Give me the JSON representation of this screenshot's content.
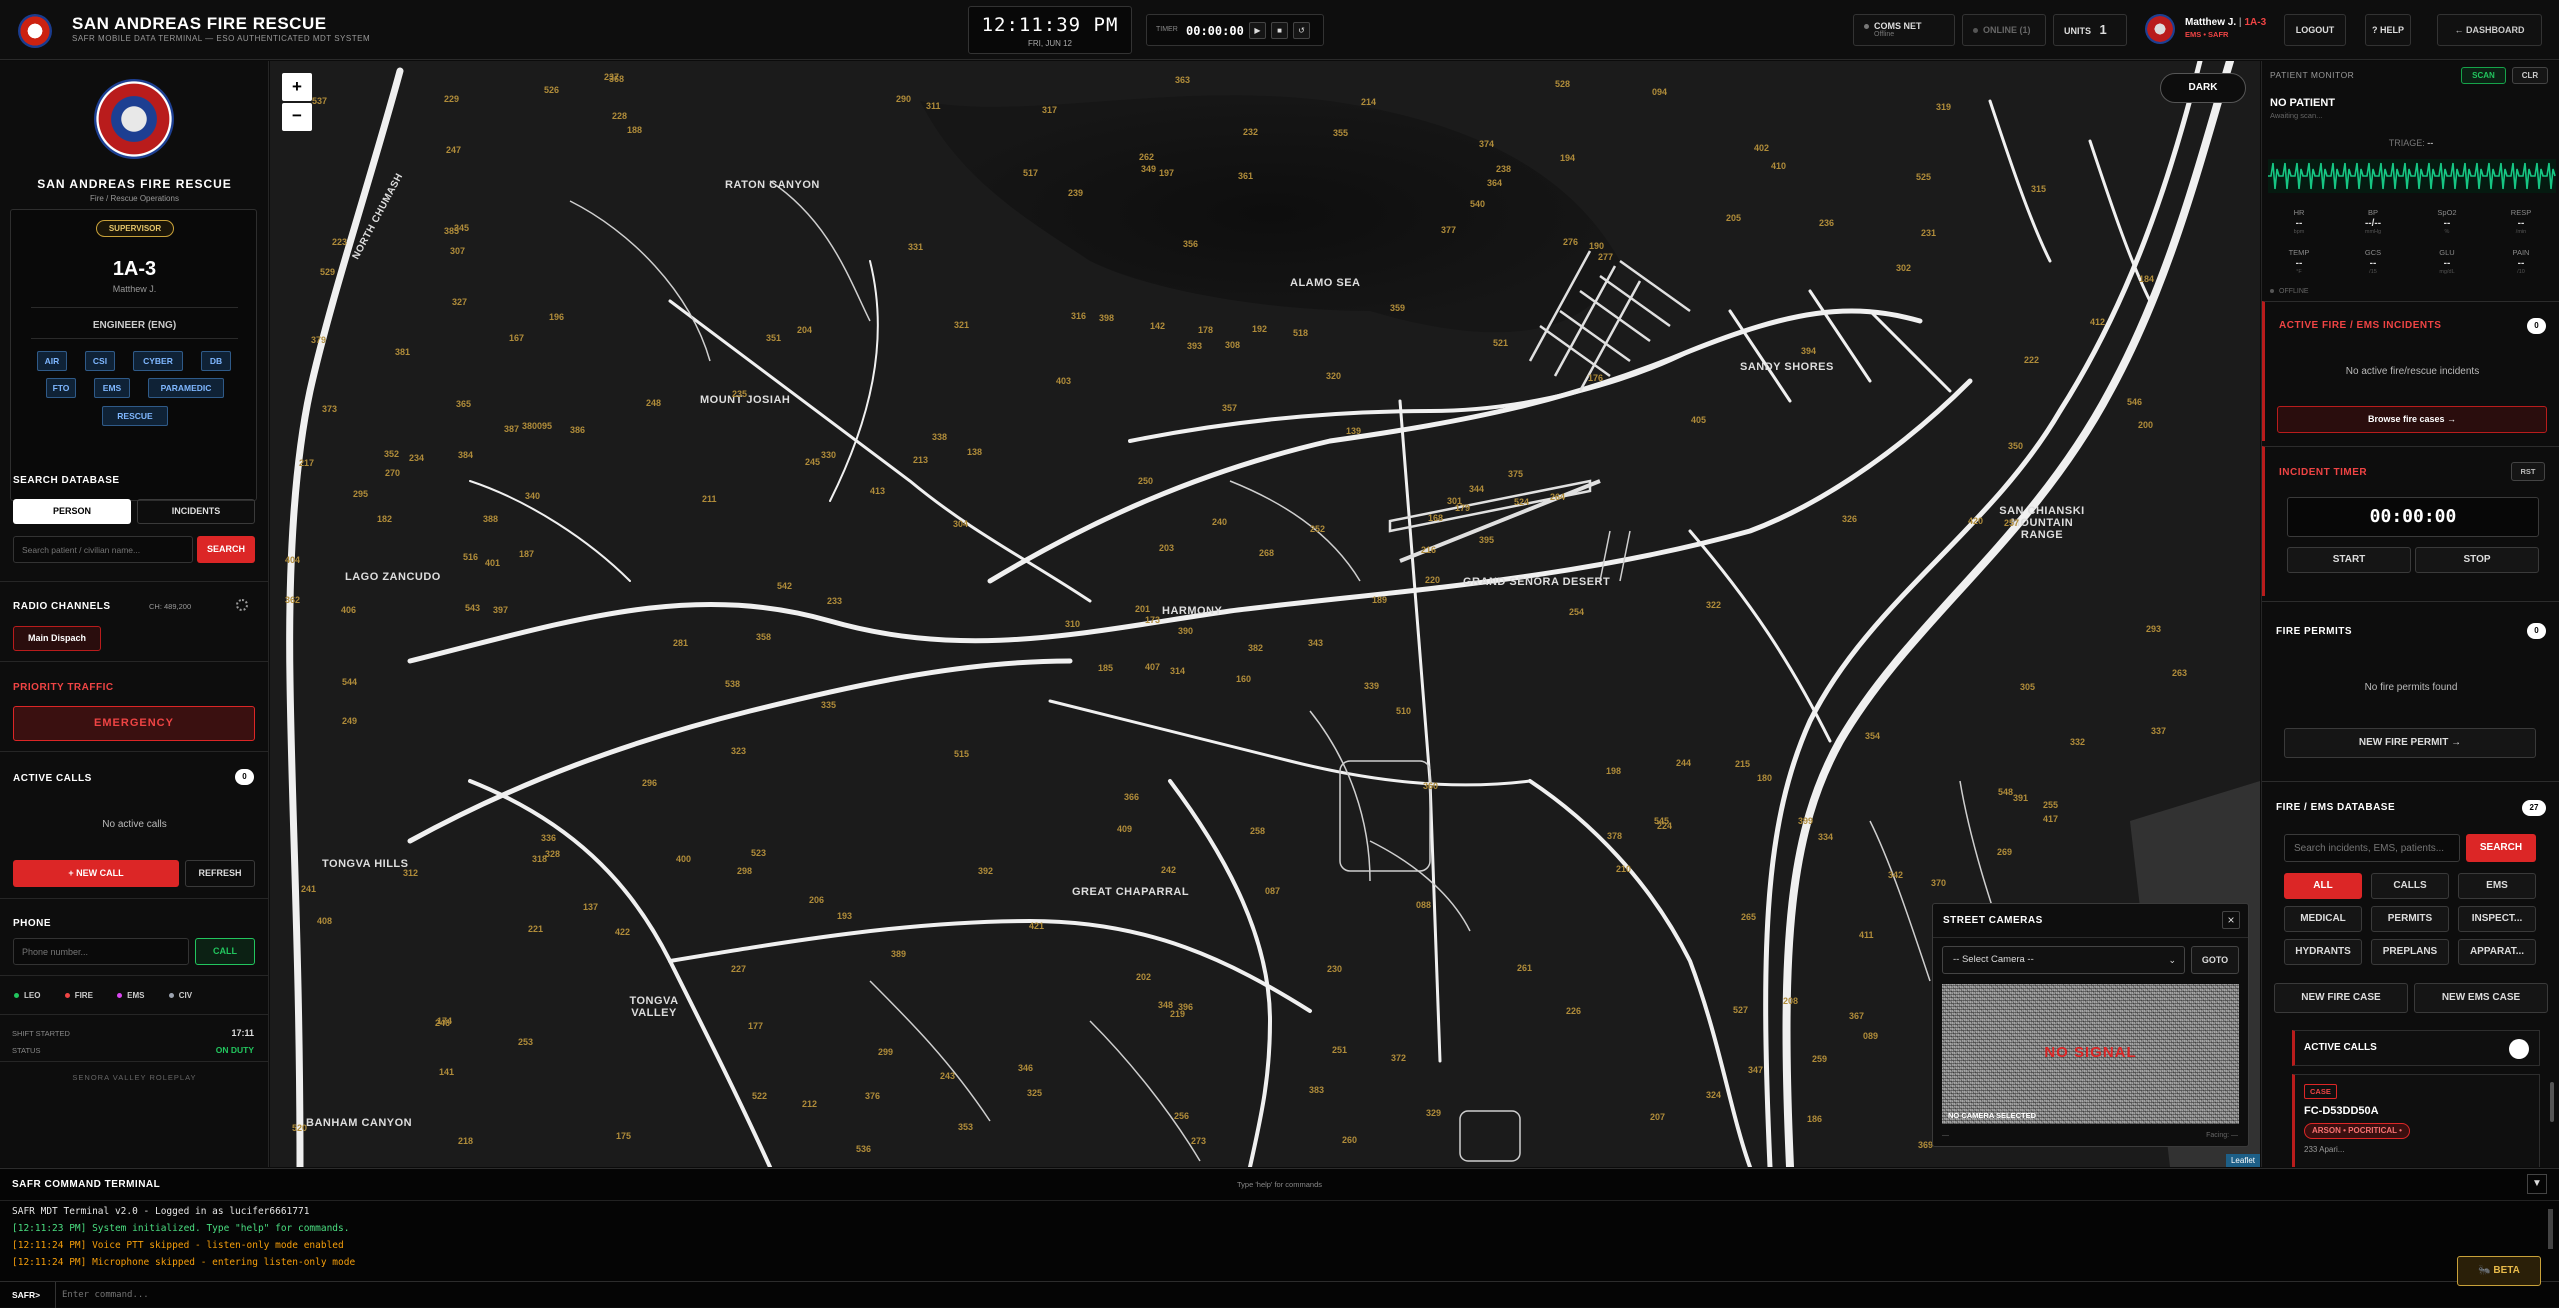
{
  "header": {
    "title": "SAN ANDREAS FIRE RESCUE",
    "subtitle": "SAFR MOBILE DATA TERMINAL — ESO AUTHENTICATED MDT SYSTEM",
    "clock": "12:11:39 PM",
    "date": "FRI, JUN 12",
    "timer_label": "TIMER",
    "timer_value": "00:00:00",
    "timer_play": "▶",
    "timer_stop": "■",
    "timer_reset": "↺",
    "comms_label": "COMS NET",
    "comms_sub": "Offline",
    "online_label": "ONLINE (1)",
    "units_label": "UNITS",
    "units_count": "1",
    "user_name": "Matthew J.",
    "user_unit": "1A-3",
    "user_dept": "EMS • SAFR",
    "logout": "LOGOUT",
    "help": "? HELP",
    "dashboard": "← DASHBOARD"
  },
  "sidebar": {
    "org_name": "SAN ANDREAS FIRE RESCUE",
    "org_sub": "Fire / Rescue Operations",
    "rank_badge": "SUPERVISOR",
    "callsign": "1A-3",
    "user": "Matthew J.",
    "role": "ENGINEER (ENG)",
    "certs": [
      "AIR",
      "CSI",
      "CYBER",
      "DB",
      "FTO",
      "EMS",
      "PARAMEDIC",
      "RESCUE"
    ],
    "search_title": "SEARCH DATABASE",
    "tab_person": "PERSON",
    "tab_incidents": "INCIDENTS",
    "search_placeholder": "Search patient / civilian name...",
    "search_button": "SEARCH",
    "radio_title": "RADIO CHANNELS",
    "radio_ch": "CH: 489,200",
    "radio_channel": "Main Dispach",
    "priority_title": "PRIORITY TRAFFIC",
    "emergency_button": "EMERGENCY",
    "calls_title": "ACTIVE CALLS",
    "calls_count": "0",
    "calls_empty": "No active calls",
    "new_call": "+ NEW CALL",
    "refresh": "REFRESH",
    "phone_title": "PHONE",
    "phone_placeholder": "Phone number...",
    "call_button": "CALL",
    "legend": [
      {
        "label": "LEO",
        "color": "#22c55e"
      },
      {
        "label": "FIRE",
        "color": "#ef4444"
      },
      {
        "label": "EMS",
        "color": "#d946ef"
      },
      {
        "label": "CIV",
        "color": "#9ca3af"
      }
    ],
    "shift_label": "SHIFT STARTED",
    "shift_value": "17:11",
    "status_label": "STATUS",
    "status_value": "ON DUTY",
    "footer": "SENORA VALLEY ROLEPLAY"
  },
  "map": {
    "zoom_in": "+",
    "zoom_out": "−",
    "theme_button": "DARK",
    "attribution": "Leaflet",
    "labels": [
      "RATON CANYON",
      "ALAMO SEA",
      "MOUNT JOSIAH",
      "SANDY SHORES",
      "LAGO ZANCUDO",
      "HARMONY",
      "GRAND SENORA DESERT",
      "SAN CHIANSKI MOUNTAIN RANGE",
      "TONGVA HILLS",
      "GREAT CHAPARRAL",
      "TONGVA VALLEY",
      "BANHAM CANYON",
      "NORTH CHUMASH"
    ],
    "postals": [
      "160",
      "167",
      "173",
      "174",
      "168",
      "193",
      "194",
      "192",
      "190",
      "189",
      "188",
      "186",
      "187",
      "184",
      "185",
      "176",
      "175",
      "142",
      "139",
      "137",
      "138",
      "141",
      "177",
      "178",
      "179",
      "180",
      "196",
      "197",
      "182",
      "198",
      "200",
      "201",
      "202",
      "203",
      "204",
      "205",
      "206",
      "207",
      "208",
      "215",
      "214",
      "213",
      "211",
      "210",
      "212",
      "217",
      "216",
      "218",
      "219",
      "220",
      "221",
      "222",
      "223",
      "224",
      "226",
      "227",
      "228",
      "229",
      "230",
      "231",
      "232",
      "233",
      "234",
      "235",
      "236",
      "237",
      "238",
      "239",
      "240",
      "241",
      "242",
      "243",
      "244",
      "245",
      "246",
      "247",
      "248",
      "249",
      "250",
      "251",
      "252",
      "253",
      "254",
      "255",
      "256",
      "257",
      "258",
      "259",
      "260",
      "261",
      "262",
      "263",
      "264",
      "265",
      "268",
      "269",
      "270",
      "273",
      "276",
      "277",
      "281",
      "290",
      "293",
      "295",
      "296",
      "298",
      "299",
      "301",
      "302",
      "304",
      "305",
      "307",
      "308",
      "310",
      "311",
      "312",
      "314",
      "315",
      "316",
      "317",
      "318",
      "319",
      "320",
      "321",
      "322",
      "323",
      "324",
      "325",
      "326",
      "327",
      "328",
      "329",
      "330",
      "331",
      "332",
      "334",
      "335",
      "336",
      "337",
      "338",
      "339",
      "340",
      "342",
      "343",
      "344",
      "345",
      "346",
      "347",
      "348",
      "349",
      "350",
      "351",
      "352",
      "353",
      "354",
      "355",
      "356",
      "357",
      "358",
      "359",
      "360",
      "361",
      "362",
      "363",
      "364",
      "365",
      "366",
      "367",
      "368",
      "369",
      "370",
      "372",
      "373",
      "374",
      "375",
      "376",
      "377",
      "378",
      "379",
      "380",
      "381",
      "382",
      "383",
      "384",
      "385",
      "386",
      "387",
      "388",
      "389",
      "390",
      "391",
      "392",
      "393",
      "394",
      "395",
      "396",
      "397",
      "398",
      "399",
      "400",
      "401",
      "402",
      "403",
      "404",
      "405",
      "406",
      "407",
      "408",
      "409",
      "410",
      "411",
      "412",
      "413",
      "417",
      "420",
      "421",
      "422",
      "510",
      "515",
      "516",
      "517",
      "518",
      "520",
      "521",
      "522",
      "523",
      "524",
      "525",
      "526",
      "527",
      "528",
      "529",
      "536",
      "537",
      "538",
      "540",
      "542",
      "543",
      "544",
      "545",
      "546",
      "548",
      "094",
      "095",
      "087",
      "088",
      "089"
    ]
  },
  "cameras": {
    "title": "STREET CAMERAS",
    "close": "×",
    "select": "-- Select Camera --",
    "goto": "GOTO",
    "no_signal": "NO SIGNAL",
    "no_camera": "NO CAMERA SELECTED",
    "footer_left": "—",
    "footer_right": "Facing: —"
  },
  "patient": {
    "title": "PATIENT MONITOR",
    "scan": "SCAN",
    "clr": "CLR",
    "name": "NO PATIENT",
    "status": "Awaiting scan...",
    "triage_label": "TRIAGE:",
    "triage_value": "--",
    "vitals": [
      {
        "k": "HR",
        "v": "--",
        "u": "bpm"
      },
      {
        "k": "BP",
        "v": "--/--",
        "u": "mmHg"
      },
      {
        "k": "SpO2",
        "v": "--",
        "u": "%"
      },
      {
        "k": "RESP",
        "v": "--",
        "u": "/min"
      },
      {
        "k": "TEMP",
        "v": "--",
        "u": "°F"
      },
      {
        "k": "GCS",
        "v": "--",
        "u": "/15"
      },
      {
        "k": "GLU",
        "v": "--",
        "u": "mg/dL"
      },
      {
        "k": "PAIN",
        "v": "--",
        "u": "/10"
      }
    ],
    "offline": "OFFLINE"
  },
  "incidents": {
    "title": "ACTIVE FIRE / EMS INCIDENTS",
    "count": "0",
    "empty": "No active fire/rescue incidents",
    "browse": "Browse fire cases →"
  },
  "incident_timer": {
    "title": "INCIDENT TIMER",
    "rst": "RST",
    "value": "00:00:00",
    "start": "START",
    "stop": "STOP"
  },
  "permits": {
    "title": "FIRE PERMITS",
    "count": "0",
    "empty": "No fire permits found",
    "new": "NEW FIRE PERMIT →"
  },
  "database": {
    "title": "FIRE / EMS DATABASE",
    "count": "27",
    "placeholder": "Search incidents, EMS, patients...",
    "search": "SEARCH",
    "filters": [
      "ALL",
      "CALLS",
      "EMS",
      "MEDICAL",
      "PERMITS",
      "INSPECT...",
      "HYDRANTS",
      "PREPLANS",
      "APPARAT..."
    ],
    "new_fire_case": "NEW FIRE CASE",
    "new_ems_case": "NEW EMS CASE",
    "active_calls": "ACTIVE CALLS",
    "case_tag": "CASE",
    "case_id": "FC-D53DD50A",
    "case_badge": "ARSON • POCRITICAL •",
    "case_more": "233 Apari..."
  },
  "terminal": {
    "title": "SAFR COMMAND TERMINAL",
    "hint": "Type 'help' for commands",
    "collapse": "▼",
    "lines": [
      {
        "text": "SAFR MDT Terminal v2.0 - Logged in as lucifer6661771",
        "color": "#e5e5e5"
      },
      {
        "text": "[12:11:23 PM] System initialized. Type \"help\" for commands.",
        "color": "#4ade80"
      },
      {
        "text": "[12:11:24 PM] Voice PTT skipped - listen-only mode enabled",
        "color": "#f59e0b"
      },
      {
        "text": "[12:11:24 PM] Microphone skipped - entering listen-only mode",
        "color": "#f59e0b"
      }
    ],
    "prompt": "SAFR>",
    "input_placeholder": "Enter command...",
    "beta": "BETA"
  },
  "colors": {
    "accent_red": "#dc2626",
    "accent_green": "#22c55e",
    "accent_gold": "#c9a23a",
    "monitor_green": "#16c784"
  }
}
